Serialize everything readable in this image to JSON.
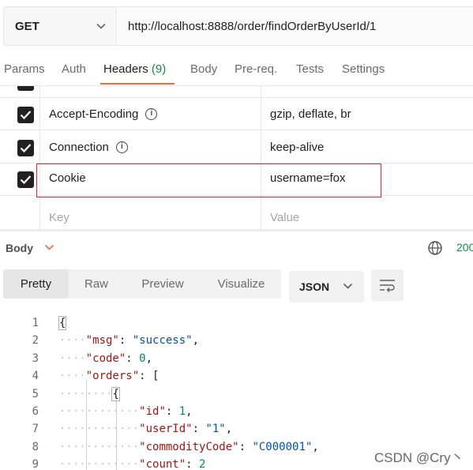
{
  "request": {
    "method": "GET",
    "url": "http://localhost:8888/order/findOrderByUserId/1"
  },
  "tabs": [
    {
      "label": "Params"
    },
    {
      "label": "Auth"
    },
    {
      "label": "Headers",
      "count": "(9)"
    },
    {
      "label": "Body"
    },
    {
      "label": "Pre-req."
    },
    {
      "label": "Tests"
    },
    {
      "label": "Settings"
    }
  ],
  "headers": [
    {
      "key": "Accept-Encoding",
      "value": "gzip, deflate, br",
      "checked": true,
      "info": true
    },
    {
      "key": "Connection",
      "value": "keep-alive",
      "checked": true,
      "info": true
    },
    {
      "key": "Cookie",
      "value": "username=fox",
      "checked": true,
      "info": false
    }
  ],
  "new_header": {
    "key_placeholder": "Key",
    "value_placeholder": "Value"
  },
  "response": {
    "label": "Body",
    "status": "200",
    "views": [
      "Pretty",
      "Raw",
      "Preview",
      "Visualize"
    ],
    "format": "JSON"
  },
  "code_lines": [
    {
      "n": "1",
      "indent": "",
      "html": "{"
    },
    {
      "n": "2",
      "indent": "····",
      "key": "\"msg\"",
      "sep": ": ",
      "val": "\"success\"",
      "vt": "s",
      "tail": ","
    },
    {
      "n": "3",
      "indent": "····",
      "key": "\"code\"",
      "sep": ": ",
      "val": "0",
      "vt": "n",
      "tail": ","
    },
    {
      "n": "4",
      "indent": "····",
      "key": "\"orders\"",
      "sep": ": ",
      "val": "",
      "vt": "",
      "tail": "["
    },
    {
      "n": "5",
      "indent": "········",
      "key": "",
      "sep": "",
      "val": "",
      "vt": "",
      "tail": "{"
    },
    {
      "n": "6",
      "indent": "············",
      "key": "\"id\"",
      "sep": ": ",
      "val": "1",
      "vt": "n",
      "tail": ","
    },
    {
      "n": "7",
      "indent": "············",
      "key": "\"userId\"",
      "sep": ": ",
      "val": "\"1\"",
      "vt": "s",
      "tail": ","
    },
    {
      "n": "8",
      "indent": "············",
      "key": "\"commodityCode\"",
      "sep": ": ",
      "val": "\"C000001\"",
      "vt": "s",
      "tail": ","
    },
    {
      "n": "9",
      "indent": "············",
      "key": "\"count\"",
      "sep": ": ",
      "val": "2",
      "vt": "n",
      "tail": ""
    }
  ],
  "watermark": "CSDN @Cry丶",
  "colors": {
    "accent": "#f26b3a",
    "status_ok": "#168a4a",
    "highlight_box": "#d23030"
  }
}
